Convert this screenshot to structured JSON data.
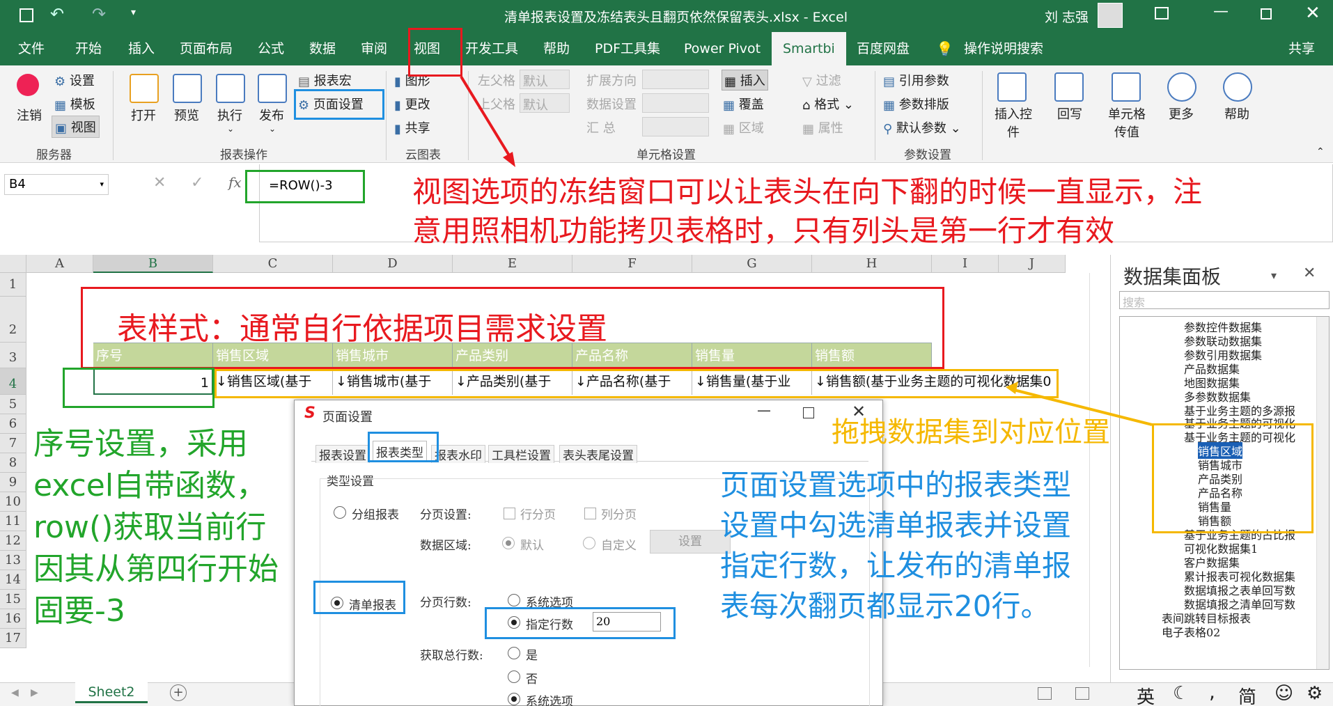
{
  "window": {
    "title": "清单报表设置及冻结表头且翻页依然保留表头.xlsx  -  Excel",
    "user": "刘 志强",
    "share": "共享"
  },
  "tabs": [
    "文件",
    "开始",
    "插入",
    "页面布局",
    "公式",
    "数据",
    "审阅",
    "视图",
    "开发工具",
    "帮助",
    "PDF工具集",
    "Power Pivot",
    "Smartbi",
    "百度网盘",
    "操作说明搜索"
  ],
  "ribbon": {
    "server": {
      "logout": "注销",
      "settings": "设置",
      "template": "模板",
      "view": "视图",
      "group": "服务器"
    },
    "report_ops": {
      "open": "打开",
      "preview": "预览",
      "run": "执行",
      "publish": "发布",
      "macro": "报表宏",
      "page_setup": "页面设置",
      "group": "报表操作"
    },
    "cloud": {
      "chart": "图形",
      "update": "更改",
      "share": "共享",
      "group": "云图表"
    },
    "cell": {
      "left_parent": "左父格",
      "top_parent": "上父格",
      "default": "默认",
      "expand_dir": "扩展方向",
      "data_setting": "数据设置",
      "summary": "汇    总",
      "insert": "插入",
      "cover": "覆盖",
      "area": "区域",
      "filter": "过滤",
      "format": "格式",
      "attr": "属性",
      "group": "单元格设置"
    },
    "params": {
      "ref": "引用参数",
      "layout": "参数排版",
      "default": "默认参数",
      "group": "参数设置"
    },
    "insert_ctrl": "插入控件",
    "writeback": "回写",
    "cell_transfer": "单元格传值",
    "more": "更多",
    "help": "帮助"
  },
  "formula": {
    "namebox": "B4",
    "fx": "fx",
    "value": "=ROW()-3"
  },
  "columns": [
    "A",
    "B",
    "C",
    "D",
    "E",
    "F",
    "G",
    "H",
    "I",
    "J"
  ],
  "rows": [
    "1",
    "2",
    "3",
    "4",
    "5",
    "6",
    "7",
    "8",
    "9",
    "10",
    "11",
    "12",
    "13",
    "14",
    "15",
    "16",
    "17"
  ],
  "header_cells": [
    "序号",
    "销售区域",
    "销售城市",
    "产品类别",
    "产品名称",
    "销售量",
    "销售额"
  ],
  "data_cells": [
    "1",
    "↓销售区域(基于",
    "↓销售城市(基于",
    "↓产品类别(基于",
    "↓产品名称(基于",
    "↓销售量(基于业",
    "↓销售额(基于业务主题的可视化数据集0"
  ],
  "sheet_tab": "Sheet2",
  "panel": {
    "title": "数据集面板",
    "search_placeholder": "搜索",
    "items": [
      "参数控件数据集",
      "参数联动数据集",
      "参数引用数据集",
      "产品数据集",
      "地图数据集",
      "多参数数据集",
      "基于业务主题的多源报",
      "基于业务主题的可视化",
      "基于业务主题的可视化",
      "销售区域",
      "销售城市",
      "产品类别",
      "产品名称",
      "销售量",
      "销售额",
      "基于业务主题的占比报",
      "可视化数据集1",
      "客户数据集",
      "累计报表可视化数据集",
      "数据填报之表单回写数",
      "数据填报之清单回写数",
      "表间跳转目标报表",
      "电子表格02"
    ]
  },
  "dialog": {
    "title": "页面设置",
    "tabs": [
      "报表设置",
      "报表类型",
      "报表水印",
      "工具栏设置",
      "表头表尾设置"
    ],
    "section": "类型设置",
    "group_report": "分组报表",
    "page_setting": "分页设置:",
    "row_page": "行分页",
    "col_page": "列分页",
    "data_area": "数据区域:",
    "default": "默认",
    "custom": "自定义",
    "set_btn": "设置",
    "list_report": "清单报表",
    "page_rows": "分页行数:",
    "sys_opt": "系统选项",
    "specified_rows": "指定行数",
    "rows_value": "20",
    "get_total": "获取总行数:",
    "yes": "是",
    "no": "否",
    "sys_opt2": "系统选项"
  },
  "status": {
    "ime": "英",
    "simp": "简"
  },
  "annotations": {
    "freeze": [
      "视图选项的冻结窗口可以让表头在向下翻的时候一直显示，注",
      "意用照相机功能拷贝表格时，只有列头是第一行才有效"
    ],
    "style": "表样式：通常自行依据项目需求设置",
    "seq": [
      "序号设置，采用",
      "excel自带函数，",
      "row()获取当前行",
      "因其从第四行开始",
      "固要-3"
    ],
    "drag": "拖拽数据集到对应位置",
    "pagesetup": [
      "页面设置选项中的报表类型",
      "设置中勾选清单报表并设置",
      "指定行数，让发布的清单报",
      "表每次翻页都显示20行。"
    ]
  },
  "colors": {
    "excel_green": "#217346",
    "red": "#e8191f",
    "green": "#22a52b",
    "blue": "#1f8fe0",
    "orange": "#f5b800",
    "header_fill": "#c4d79b"
  }
}
